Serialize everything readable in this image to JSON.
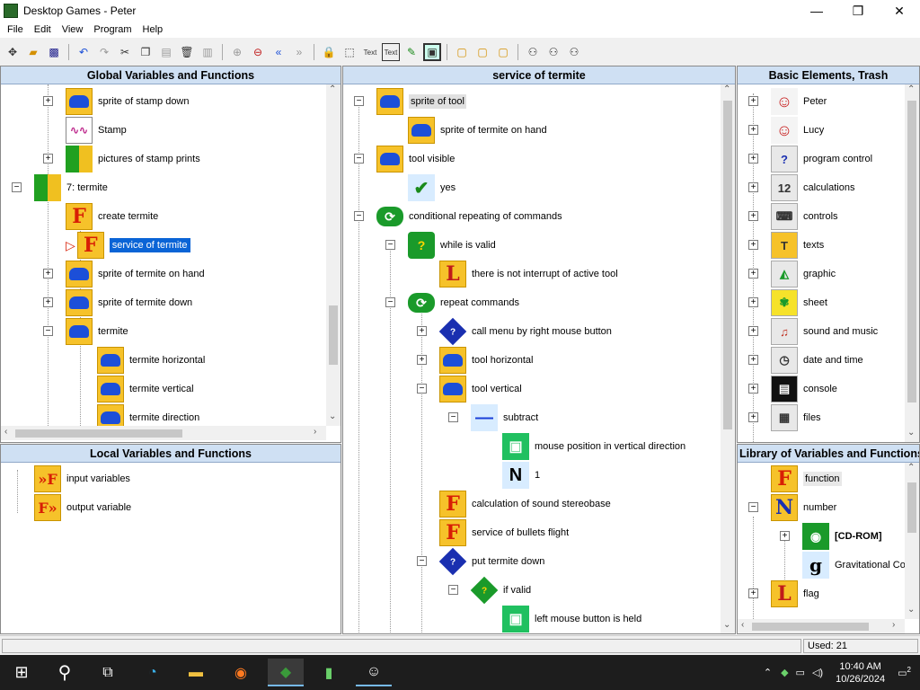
{
  "window": {
    "title": "Desktop Games - Peter",
    "minimize": "—",
    "maximize": "❐",
    "close": "✕"
  },
  "menu": [
    "File",
    "Edit",
    "View",
    "Program",
    "Help"
  ],
  "toolbar_icons": [
    "tree-icon",
    "open-icon",
    "save-icon",
    "undo-icon",
    "redo-icon",
    "cut-icon",
    "copy-icon",
    "paste-icon",
    "delete-icon",
    "disabled-icon",
    "zoom-in-icon",
    "zoom-out-icon",
    "collapse-icon",
    "expand-icon",
    "lock-icon",
    "select-icon",
    "text-icon",
    "text-box-icon",
    "edit-icon",
    "frame-icon",
    "lock-yellow-icon",
    "lock-open-icon",
    "lock-key-icon",
    "binoculars-icon",
    "binoculars-next-icon",
    "binoculars-prev-icon"
  ],
  "global_panel": {
    "header": "Global Variables and Functions",
    "items": [
      {
        "label": "sprite of stamp down"
      },
      {
        "label": "Stamp"
      },
      {
        "label": "pictures of stamp prints"
      },
      {
        "label": "7: termite"
      },
      {
        "label": "create termite"
      },
      {
        "label": "service of termite"
      },
      {
        "label": "sprite of termite on hand"
      },
      {
        "label": "sprite of termite down"
      },
      {
        "label": "termite"
      },
      {
        "label": "termite horizontal"
      },
      {
        "label": "termite vertical"
      },
      {
        "label": "termite direction"
      }
    ]
  },
  "local_panel": {
    "header": "Local Variables and Functions",
    "items": [
      {
        "label": "input variables"
      },
      {
        "label": "output variable"
      }
    ]
  },
  "service_panel": {
    "header": "service of termite",
    "items": [
      {
        "label": "sprite of tool"
      },
      {
        "label": "sprite of termite on hand"
      },
      {
        "label": "tool visible"
      },
      {
        "label": "yes"
      },
      {
        "label": "conditional repeating of commands"
      },
      {
        "label": "while is valid"
      },
      {
        "label": "there is not interrupt of active tool"
      },
      {
        "label": "repeat commands"
      },
      {
        "label": "call menu by right mouse button"
      },
      {
        "label": "tool horizontal"
      },
      {
        "label": "tool vertical"
      },
      {
        "label": "subtract"
      },
      {
        "label": "mouse position in vertical direction"
      },
      {
        "label": "1"
      },
      {
        "label": "calculation of sound stereobase"
      },
      {
        "label": "service of bullets flight"
      },
      {
        "label": "put termite down"
      },
      {
        "label": "if valid"
      },
      {
        "label": "left mouse button is held"
      }
    ]
  },
  "basic_panel": {
    "header": "Basic Elements, Trash",
    "items": [
      {
        "label": "Peter"
      },
      {
        "label": "Lucy"
      },
      {
        "label": "program control"
      },
      {
        "label": "calculations"
      },
      {
        "label": "controls"
      },
      {
        "label": "texts"
      },
      {
        "label": "graphic"
      },
      {
        "label": "sheet"
      },
      {
        "label": "sound and music"
      },
      {
        "label": "date and time"
      },
      {
        "label": "console"
      },
      {
        "label": "files"
      }
    ]
  },
  "library_panel": {
    "header": "Library of Variables and Functions",
    "items": [
      {
        "label": "function"
      },
      {
        "label": "number"
      },
      {
        "label": "[CD-ROM]"
      },
      {
        "label": "Gravitational Co"
      },
      {
        "label": "flag"
      }
    ]
  },
  "icon_glyphs": {
    "F": "F",
    "L": "L",
    "N": "N",
    "g": "g",
    "one": "1",
    "minus": "—",
    "check": "✔",
    "question": "?",
    "loop": "⟳",
    "mouse": "▣",
    "abc": "T",
    "calc": "12",
    "peter": "☺",
    "clock": "◷"
  },
  "statusbar": {
    "used": "Used: 21"
  },
  "taskbar": {
    "time": "10:40 AM",
    "date": "10/26/2024",
    "notifications": "2"
  },
  "colors": {
    "header_bg": "#cfe0f3",
    "selection": "#0a64d6",
    "function_icon": "#f6c22a",
    "taskbar": "#1d1d1d"
  }
}
